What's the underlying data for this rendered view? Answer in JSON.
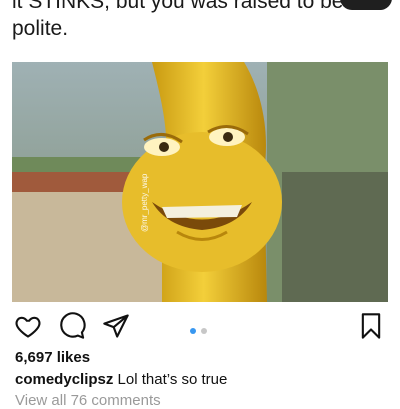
{
  "post": {
    "caption_lines": [
      "it STINKS, but you was raised to be",
      "polite."
    ],
    "image": {
      "watermark": "@mr_petty_wap",
      "description_colors": {
        "banana": "#e9c12a",
        "sky": "#8fa3a6"
      }
    },
    "actions": {
      "like_icon": "heart-icon",
      "comment_icon": "comment-icon",
      "share_icon": "send-icon",
      "save_icon": "bookmark-icon"
    },
    "carousel": {
      "count": 2,
      "active_index": 0,
      "active_color": "#3897f0",
      "inactive_color": "#c7c7c7"
    },
    "likes": "6,697 likes",
    "comment": {
      "username": "comedyclipsz",
      "text": "Lol that’s so true"
    },
    "view_all_comments": "View all 76 comments"
  }
}
